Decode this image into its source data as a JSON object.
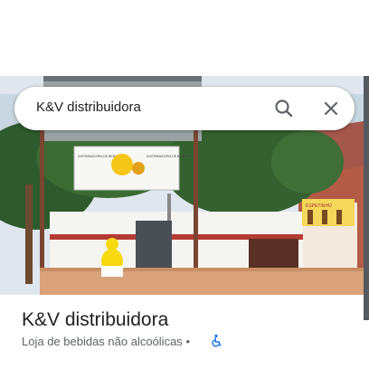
{
  "search": {
    "query": "K&V distribuidora"
  },
  "photo": {
    "sign_left_text": "DISTRIBUIDORA DE BEBIDAS",
    "sign_right_text": "DISTRIBUIDORA DE BEBIDAS",
    "poster_text": "ESPETINHO",
    "colors": {
      "sky": "#dfe6ee",
      "wall": "#f4f4f0",
      "ledge": "#d9a27a",
      "roof": "#a5574b",
      "tree": "#2f5a2d"
    }
  },
  "place": {
    "name": "K&V distribuidora",
    "category": "Loja de bebidas não alcoólicas",
    "separator": "•"
  },
  "icons": {
    "search": "search-icon",
    "close": "close-icon",
    "accessibility": "wheelchair-accessible-icon"
  },
  "colors": {
    "accessibility": "#1a73e8",
    "text_primary": "#202124",
    "text_secondary": "#5f6368"
  }
}
